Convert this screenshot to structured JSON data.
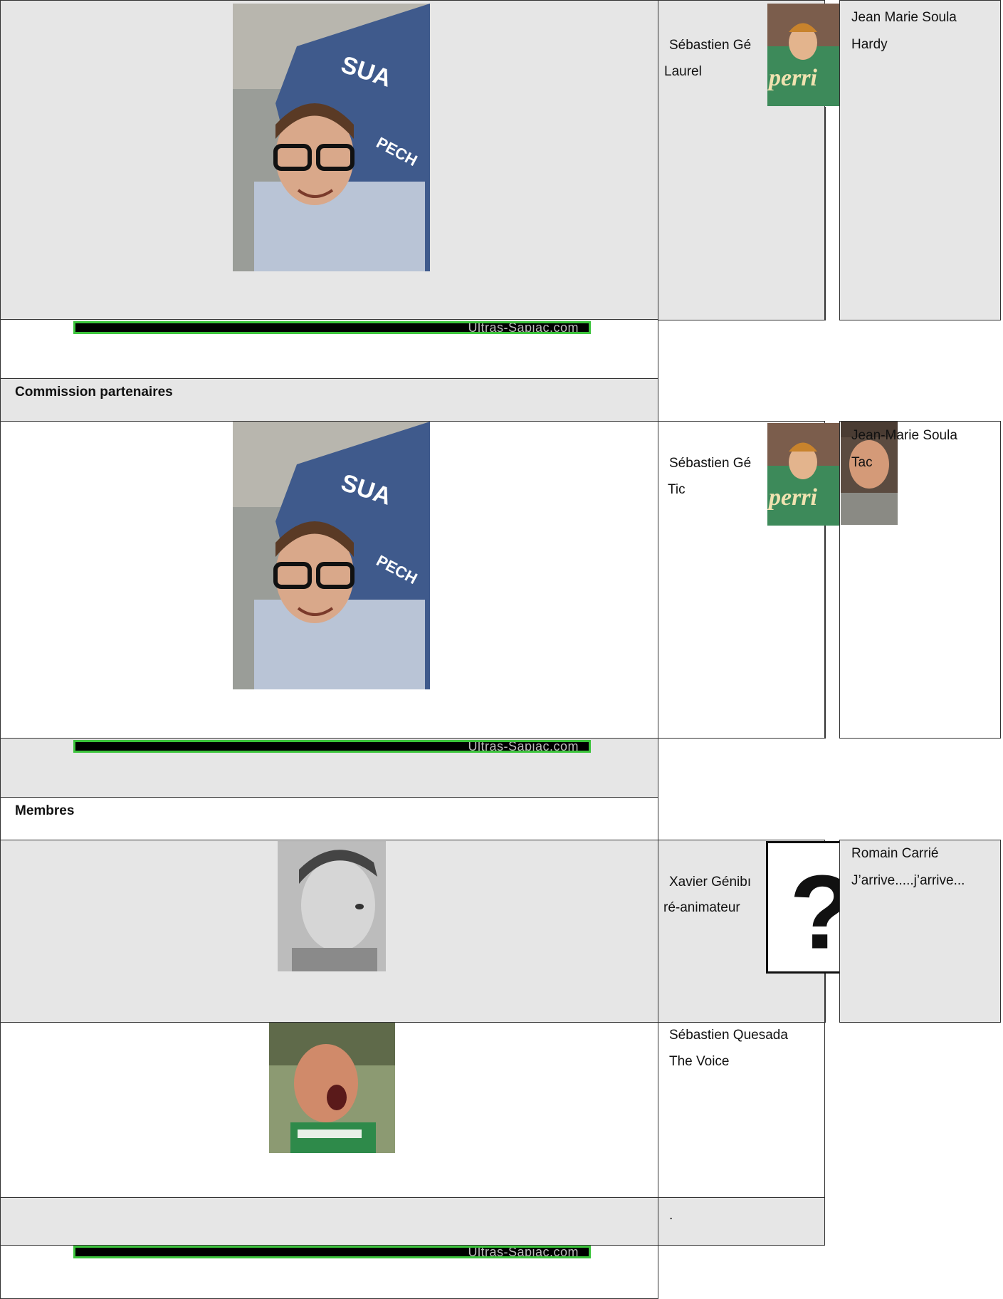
{
  "banner": {
    "text": "Ultras-Sapiac.com"
  },
  "sections": {
    "partners_heading": "Commission partenaires",
    "members_heading": "Membres"
  },
  "cards": {
    "laurel": {
      "name": "Sébastien Gé",
      "nickname": "Laurel"
    },
    "hardy": {
      "name": "Jean Marie Soula",
      "nickname": "Hardy"
    },
    "tic": {
      "name": "Sébastien Gé",
      "nickname": "Tic"
    },
    "tac": {
      "name": "Jean-Marie Soula",
      "nickname": "Tac"
    },
    "reanimateur": {
      "name": "Xavier Génibı",
      "nickname": "ré-animateur"
    },
    "romain": {
      "name": "Romain Carrié",
      "nickname": "J’arrive.....j’arrive..."
    },
    "voice": {
      "name": "Sébastien Quesada",
      "nickname": "The Voice"
    }
  },
  "dot_row": {
    "text": "."
  },
  "icons": {
    "perrier": "perrier-ad-icon",
    "unknown": "question-mark-icon"
  }
}
